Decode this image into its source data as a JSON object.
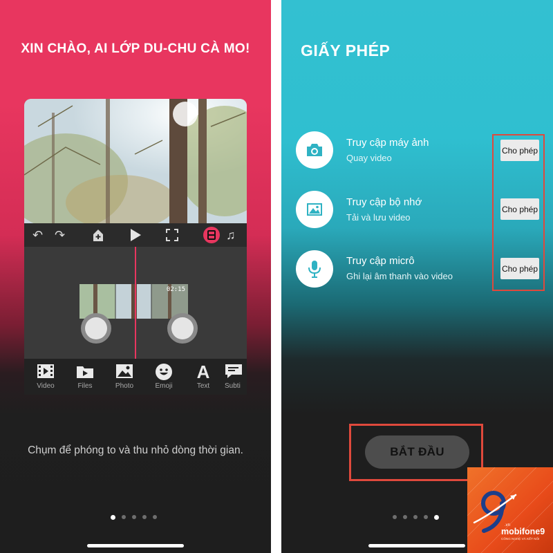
{
  "left_screen": {
    "title": "XIN CHÀO, AI LỚP DU-CHU CÀ MO!",
    "editor": {
      "clip_timecode": "02:15",
      "toolbar": [
        {
          "icon": "film-icon",
          "label": "Video"
        },
        {
          "icon": "folder-icon",
          "label": "Files"
        },
        {
          "icon": "photo-icon",
          "label": "Photo"
        },
        {
          "icon": "emoji-icon",
          "label": "Emoji"
        },
        {
          "icon": "text-icon",
          "label": "Text"
        },
        {
          "icon": "subtitle-icon",
          "label": "Subti"
        }
      ],
      "accent_color": "#e8365f"
    },
    "caption": "Chụm để phóng to và thu nhỏ dòng thời gian.",
    "pager": {
      "count": 5,
      "active": 1
    }
  },
  "right_screen": {
    "title": "GIẤY PHÉP",
    "permissions": [
      {
        "icon": "camera-icon",
        "title": "Truy cập máy ảnh",
        "subtitle": "Quay video",
        "button": "Cho phép"
      },
      {
        "icon": "image-icon",
        "title": "Truy cập bộ nhớ",
        "subtitle": "Tải và lưu video",
        "button": "Cho phép"
      },
      {
        "icon": "microphone-icon",
        "title": "Truy cập micrô",
        "subtitle": "Ghi lại âm thanh vào video",
        "button": "Cho phép"
      }
    ],
    "start_button": "BẮT ĐẦU",
    "highlight_color": "#e0493c",
    "pager": {
      "count": 5,
      "active": 5
    }
  },
  "watermark": {
    "brand": "mobifone9",
    "domain_suffix": ".vn",
    "tagline": "CÔNG NGHỆ VÀ KẾT NỐI"
  }
}
